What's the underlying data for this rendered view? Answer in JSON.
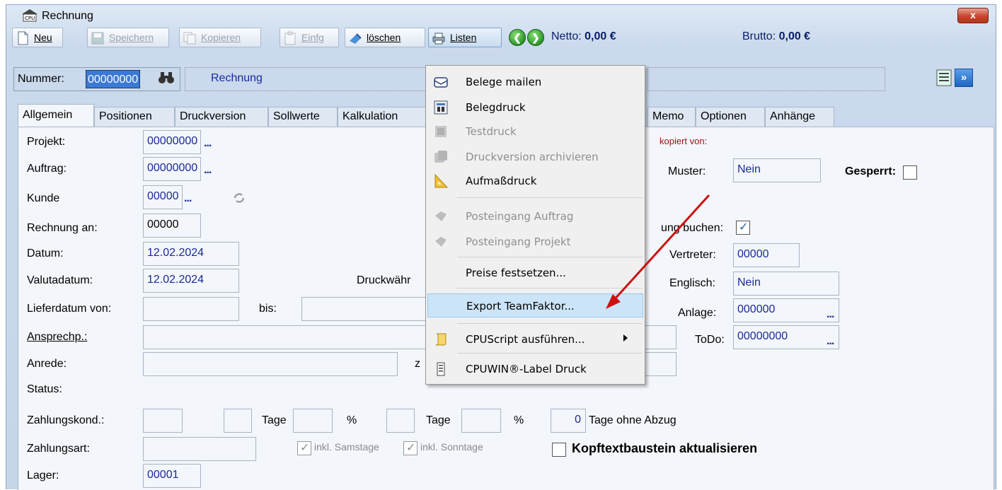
{
  "window": {
    "title": "Rechnung",
    "close_label": "x"
  },
  "toolbar": {
    "new_label": "Neu",
    "save_label": "Speichern",
    "copy_label": "Kopieren",
    "insert_label": "Einfg",
    "delete_label": "löschen",
    "lists_label": "Listen",
    "netto_label": "Netto:",
    "netto_value": "0,00 €",
    "brutto_label": "Brutto:",
    "brutto_value": "0,00 €"
  },
  "header": {
    "number_label": "Nummer:",
    "number_value": "00000000",
    "doc_type": "Rechnung"
  },
  "tabs": [
    "Allgemein",
    "Positionen",
    "Druckversion",
    "Sollwerte",
    "Kalkulation",
    "Memo",
    "Optionen",
    "Anhänge"
  ],
  "form": {
    "projekt_label": "Projekt:",
    "projekt_value": "00000000",
    "auftrag_label": "Auftrag:",
    "auftrag_value": "00000000",
    "kunde_label": "Kunde",
    "kunde_value": "00000",
    "rechnung_an_label": "Rechnung an:",
    "rechnung_an_value": "00000",
    "datum_label": "Datum:",
    "datum_value": "12.02.2024",
    "valuta_label": "Valutadatum:",
    "valuta_value": "12.02.2024",
    "druckwaehr_label": "Druckwähr",
    "lieferdatum_label": "Lieferdatum von:",
    "bis_label": "bis:",
    "ansprech_label": "Ansprechp.:",
    "anrede_label": "Anrede:",
    "z_label": "z",
    "status_label": "Status:",
    "zahlungskond_label": "Zahlungskond.:",
    "tage1_label": "Tage",
    "pct1_label": "%",
    "tage2_label": "Tage",
    "pct2_label": "%",
    "tage_ohne_value": "0",
    "tage_ohne_label": "Tage ohne Abzug",
    "zahlungsart_label": "Zahlungsart:",
    "samstage_label": "inkl. Samstage",
    "sonntage_label": "inkl. Sonntage",
    "kopftext_label": "Kopftextbaustein aktualisieren",
    "lager_label": "Lager:",
    "lager_value": "00001",
    "kopiert_label": "kopiert von:",
    "muster_label": "Muster:",
    "muster_value": "Nein",
    "gesperrt_label": "Gesperrt:",
    "buchen_label": "ung buchen:",
    "vertreter_label": "Vertreter:",
    "vertreter_value": "00000",
    "englisch_label": "Englisch:",
    "englisch_value": "Nein",
    "anlage_label": "Anlage:",
    "anlage_value": "000000",
    "todo_label": "ToDo:",
    "todo_value": "00000000"
  },
  "menu": {
    "items": [
      {
        "label": "Belege mailen",
        "icon": "envelope-icon"
      },
      {
        "label": "Belegdruck",
        "icon": "print-preview-icon"
      },
      {
        "label": "Testdruck",
        "icon": "test-print-icon"
      },
      {
        "label": "Druckversion archivieren",
        "icon": "archive-icon"
      },
      {
        "label": "Aufmaßdruck",
        "icon": "triangle-ruler-icon"
      },
      {
        "label": "Posteingang Auftrag",
        "icon": "inbox-icon"
      },
      {
        "label": "Posteingang Projekt",
        "icon": "inbox-icon"
      },
      {
        "label": "Preise festsetzen...",
        "icon": ""
      },
      {
        "label": "Export TeamFaktor...",
        "icon": ""
      },
      {
        "label": "CPUScript ausführen...",
        "icon": "scroll-icon"
      },
      {
        "label": "CPUWIN®-Label Druck",
        "icon": "label-print-icon"
      }
    ]
  },
  "colors": {
    "accent": "#1a2a9a",
    "highlight": "#cce4f7",
    "annotation_arrow": "#cc1010"
  }
}
